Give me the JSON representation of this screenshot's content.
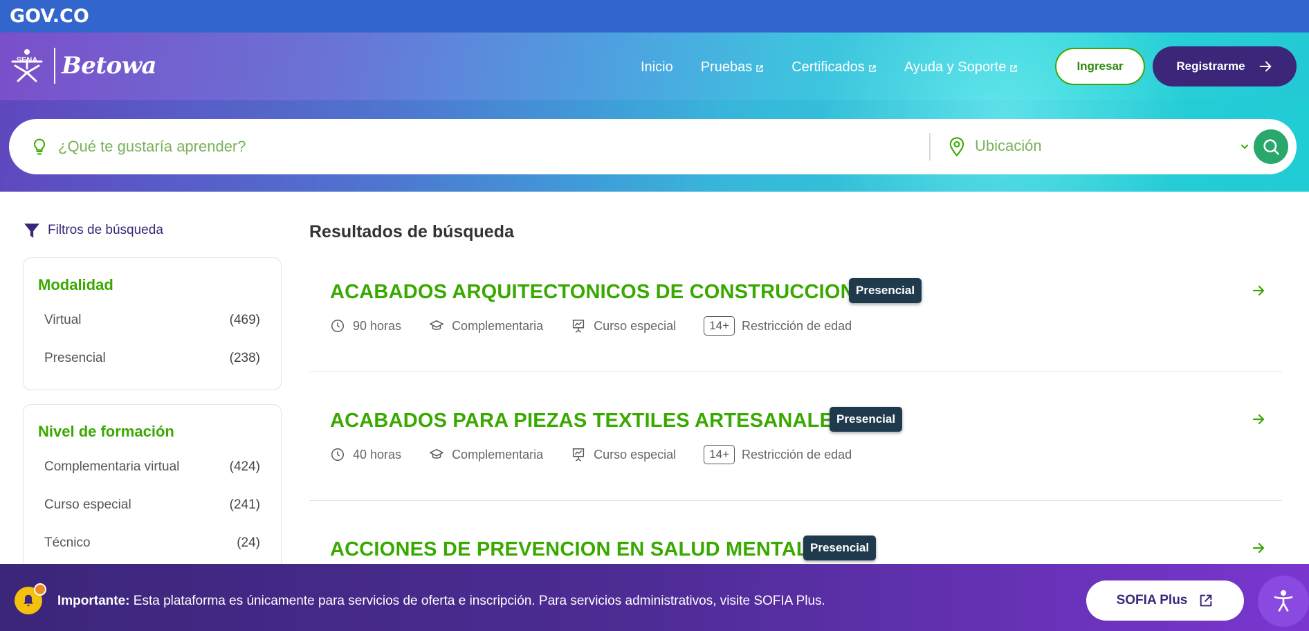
{
  "gov_bar": {
    "logo": "GOV.CO"
  },
  "brand": {
    "sena": "SENA",
    "name": "Betowa"
  },
  "nav": {
    "items": [
      {
        "label": "Inicio",
        "external": false
      },
      {
        "label": "Pruebas",
        "external": true
      },
      {
        "label": "Certificados",
        "external": true
      },
      {
        "label": "Ayuda y Soporte",
        "external": true
      }
    ],
    "login_label": "Ingresar",
    "register_label": "Registrarme"
  },
  "search": {
    "placeholder": "¿Qué te gustaría aprender?",
    "location_placeholder": "Ubicación"
  },
  "sidebar": {
    "filters_label": "Filtros de búsqueda",
    "groups": [
      {
        "title": "Modalidad",
        "options": [
          {
            "label": "Virtual",
            "count": "(469)"
          },
          {
            "label": "Presencial",
            "count": "(238)"
          }
        ]
      },
      {
        "title": "Nivel de formación",
        "options": [
          {
            "label": "Complementaria virtual",
            "count": "(424)"
          },
          {
            "label": "Curso especial",
            "count": "(241)"
          },
          {
            "label": "Técnico",
            "count": "(24)"
          }
        ]
      }
    ]
  },
  "results": {
    "title": "Resultados de búsqueda",
    "items": [
      {
        "title": "ACABADOS ARQUITECTONICOS DE CONSTRUCCION",
        "badge": "Presencial",
        "hours": "90 horas",
        "level": "Complementaria",
        "type": "Curso especial",
        "age": "14+",
        "age_label": "Restricción de edad"
      },
      {
        "title": "ACABADOS PARA PIEZAS TEXTILES ARTESANALES",
        "badge": "Presencial",
        "hours": "40 horas",
        "level": "Complementaria",
        "type": "Curso especial",
        "age": "14+",
        "age_label": "Restricción de edad"
      },
      {
        "title": "ACCIONES DE PREVENCION EN SALUD MENTAL",
        "badge": "Presencial"
      }
    ]
  },
  "banner": {
    "strong": "Importante:",
    "text": " Esta plataforma es únicamente para servicios de oferta e inscripción. Para servicios administrativos, visite SOFIA Plus.",
    "button_label": "SOFIA Plus"
  },
  "colors": {
    "gov_blue": "#3366cc",
    "sena_green": "#39a900",
    "purple": "#3b2679",
    "badge": "#1f3a4d"
  }
}
